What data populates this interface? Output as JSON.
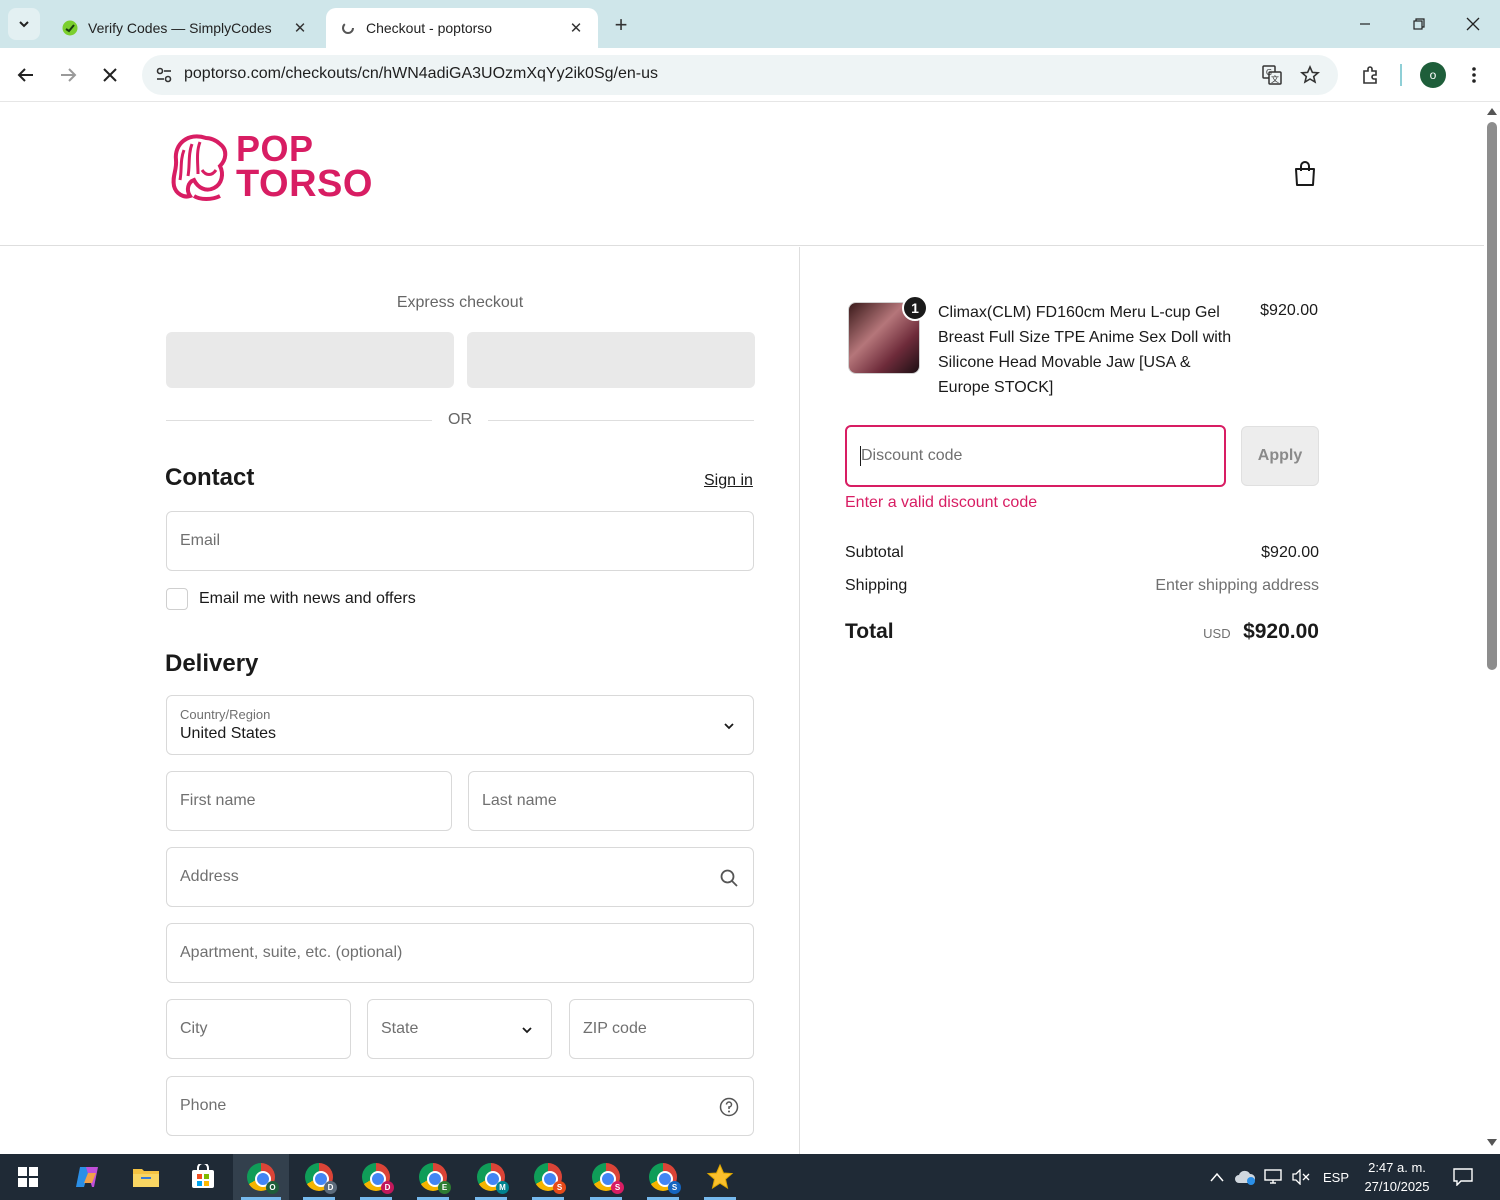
{
  "browser": {
    "tabs": [
      {
        "title": "Verify Codes — SimplyCodes",
        "active": false
      },
      {
        "title": "Checkout - poptorso",
        "active": true
      }
    ],
    "url": "poptorso.com/checkouts/cn/hWN4adiGA3UOzmXqYy2ik0Sg/en-us",
    "profile_initial": "o",
    "icons": [
      "tab-search-icon",
      "close-icon",
      "new-tab-icon",
      "minimize-icon",
      "restore-icon",
      "back-icon",
      "forward-icon",
      "stop-loading-icon",
      "site-info-icon",
      "translate-icon",
      "bookmark-star-icon",
      "extensions-icon",
      "menu-kebab-icon"
    ]
  },
  "header": {
    "logo_line1": "POP",
    "logo_line2": "TORSO",
    "cart_icon": "shopping-bag-icon"
  },
  "checkout": {
    "express_label": "Express checkout",
    "or_label": "OR",
    "contact_title": "Contact",
    "sign_in_label": "Sign in",
    "email_placeholder": "Email",
    "newsletter_label": "Email me with news and offers",
    "newsletter_checked": false,
    "delivery_title": "Delivery",
    "country_label": "Country/Region",
    "country_value": "United States",
    "first_name_placeholder": "First name",
    "last_name_placeholder": "Last name",
    "address_placeholder": "Address",
    "apartment_placeholder": "Apartment, suite, etc. (optional)",
    "city_placeholder": "City",
    "state_placeholder": "State",
    "zip_placeholder": "ZIP code",
    "phone_placeholder": "Phone"
  },
  "summary": {
    "item": {
      "quantity": "1",
      "title": "Climax(CLM) FD160cm Meru L-cup Gel Breast Full Size TPE Anime Sex Doll with Silicone Head Movable Jaw [USA & Europe STOCK]",
      "price": "$920.00"
    },
    "discount_placeholder": "Discount code",
    "apply_label": "Apply",
    "discount_error": "Enter a valid discount code",
    "subtotal_label": "Subtotal",
    "subtotal_value": "$920.00",
    "shipping_label": "Shipping",
    "shipping_value": "Enter shipping address",
    "total_label": "Total",
    "total_currency": "USD",
    "total_value": "$920.00"
  },
  "taskbar": {
    "items": [
      "start-icon",
      "copilot-icon",
      "file-explorer-icon",
      "store-icon",
      "chrome-o",
      "chrome-d",
      "chrome-d",
      "chrome-e",
      "chrome-m",
      "chrome-s",
      "chrome-s",
      "chrome-s",
      "favorites-star-icon"
    ],
    "chrome_profiles": [
      "O",
      "D",
      "D",
      "E",
      "M",
      "S",
      "S",
      "S"
    ],
    "language": "ESP",
    "time": "2:47 a. m.",
    "date": "27/10/2025"
  },
  "colors": {
    "accent": "#d81d63",
    "tabbar": "#cfe6ea",
    "taskbar": "#1f2a36"
  }
}
